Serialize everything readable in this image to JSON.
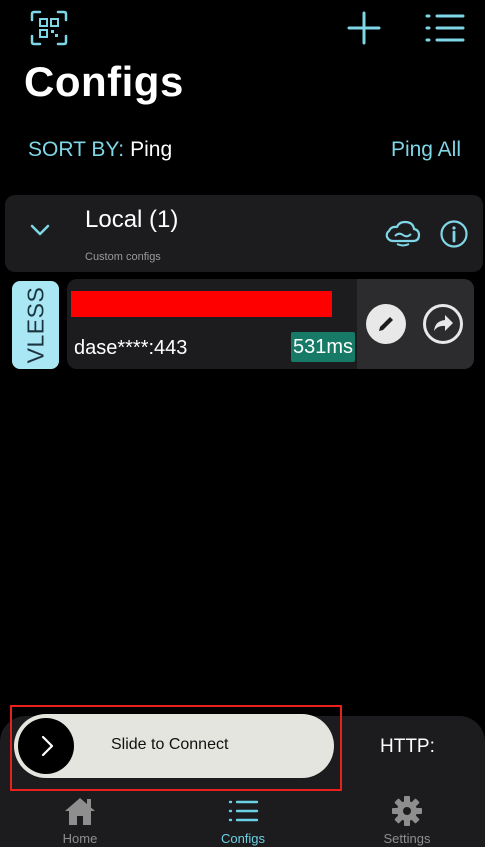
{
  "header": {
    "title": "Configs",
    "icons": {
      "qr": "qr-scan-icon",
      "add": "plus-icon",
      "list": "list-icon"
    }
  },
  "sort": {
    "label": "SORT BY:",
    "value": "Ping",
    "ping_all": "Ping All"
  },
  "group": {
    "title": "Local (1)",
    "subtitle": "Custom configs",
    "icons": [
      "chevron-down-icon",
      "cloud-icon",
      "info-icon"
    ]
  },
  "configs": [
    {
      "protocol": "VLESS",
      "address": "dase****:443",
      "ping": "531ms"
    }
  ],
  "connect": {
    "slider_label": "Slide to Connect",
    "mode_label": "HTTP:"
  },
  "tabbar": [
    {
      "label": "Home",
      "icon": "home-icon"
    },
    {
      "label": "Configs",
      "icon": "list-icon"
    },
    {
      "label": "Settings",
      "icon": "gear-icon"
    }
  ],
  "colors": {
    "accent": "#7fd6e6",
    "background": "#000000",
    "card": "#1c1c1e",
    "protocol_badge": "#a9e7f4",
    "ping_badge": "#167a66",
    "redaction": "#ff0000",
    "highlight": "#e8201f"
  }
}
